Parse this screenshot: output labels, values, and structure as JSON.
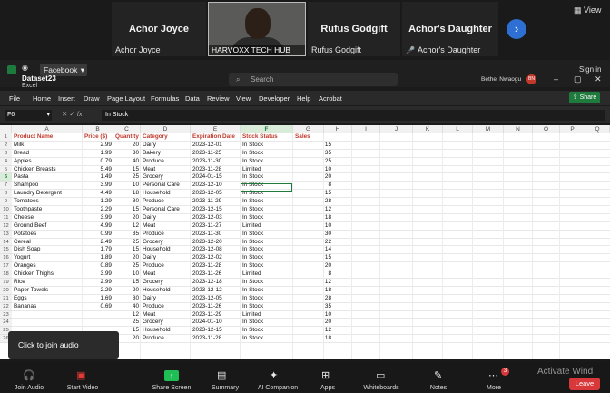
{
  "participants": [
    {
      "big": "Achor Joyce",
      "small": "Achor Joyce"
    },
    {
      "video_label": "HARVOXX TECH HUB"
    },
    {
      "big": "Rufus Godgift",
      "small": "Rufus Godgift"
    },
    {
      "big": "Achor's Daughter",
      "small": "Achor's Daughter"
    }
  ],
  "zoom_view_label": "View",
  "excel": {
    "file_name": "Dataset23",
    "app_name": "Excel",
    "tab_label": "Facebook",
    "search_placeholder": "Search",
    "user_name": "Bethel Nwaogu",
    "user_initials": "BN",
    "sign_in": "Sign in",
    "menu": [
      "File",
      "Home",
      "Insert",
      "Draw",
      "Page Layout",
      "Formulas",
      "Data",
      "Review",
      "View",
      "Developer",
      "Help",
      "Acrobat"
    ],
    "share": "Share",
    "name_box": "F6",
    "formula_value": "In Stock",
    "fx": "fx",
    "columns": [
      "A",
      "B",
      "C",
      "D",
      "E",
      "F",
      "G",
      "H",
      "I",
      "J",
      "K",
      "L",
      "M",
      "N",
      "O",
      "P",
      "Q"
    ],
    "headers": [
      "Product Name",
      "Price ($)",
      "Quantity",
      "Category",
      "Expiration Date",
      "Stock Status",
      "Sales"
    ],
    "rows": [
      [
        "Milk",
        "2.99",
        "20",
        "Dairy",
        "2023-12-01",
        "In Stock",
        "15"
      ],
      [
        "Bread",
        "1.99",
        "30",
        "Bakery",
        "2023-11-25",
        "In Stock",
        "35"
      ],
      [
        "Apples",
        "0.79",
        "40",
        "Produce",
        "2023-11-30",
        "In Stock",
        "25"
      ],
      [
        "Chicken Breasts",
        "5.49",
        "15",
        "Meat",
        "2023-11-28",
        "Limited",
        "10"
      ],
      [
        "Pasta",
        "1.49",
        "25",
        "Grocery",
        "2024-01-15",
        "In Stock",
        "20"
      ],
      [
        "Shampoo",
        "3.99",
        "10",
        "Personal Care",
        "2023-12-10",
        "In Stock",
        "8"
      ],
      [
        "Laundry Detergent",
        "4.49",
        "18",
        "Household",
        "2023-12-05",
        "In Stock",
        "15"
      ],
      [
        "Tomatoes",
        "1.29",
        "30",
        "Produce",
        "2023-11-29",
        "In Stock",
        "28"
      ],
      [
        "Toothpaste",
        "2.29",
        "15",
        "Personal Care",
        "2023-12-15",
        "In Stock",
        "12"
      ],
      [
        "Cheese",
        "3.99",
        "20",
        "Dairy",
        "2023-12-03",
        "In Stock",
        "18"
      ],
      [
        "Ground Beef",
        "4.99",
        "12",
        "Meat",
        "2023-11-27",
        "Limited",
        "10"
      ],
      [
        "Potatoes",
        "0.99",
        "35",
        "Produce",
        "2023-11-30",
        "In Stock",
        "30"
      ],
      [
        "Cereal",
        "2.49",
        "25",
        "Grocery",
        "2023-12-20",
        "In Stock",
        "22"
      ],
      [
        "Dish Soap",
        "1.79",
        "15",
        "Household",
        "2023-12-08",
        "In Stock",
        "14"
      ],
      [
        "Yogurt",
        "1.89",
        "20",
        "Dairy",
        "2023-12-02",
        "In Stock",
        "15"
      ],
      [
        "Oranges",
        "0.89",
        "25",
        "Produce",
        "2023-11-28",
        "In Stock",
        "20"
      ],
      [
        "Chicken Thighs",
        "3.99",
        "10",
        "Meat",
        "2023-11-26",
        "Limited",
        "8"
      ],
      [
        "Rice",
        "2.99",
        "15",
        "Grocery",
        "2023-12-18",
        "In Stock",
        "12"
      ],
      [
        "Paper Towels",
        "2.29",
        "20",
        "Household",
        "2023-12-12",
        "In Stock",
        "18"
      ],
      [
        "Eggs",
        "1.69",
        "30",
        "Dairy",
        "2023-12-05",
        "In Stock",
        "28"
      ],
      [
        "Bananas",
        "0.69",
        "40",
        "Produce",
        "2023-11-26",
        "In Stock",
        "35"
      ],
      [
        "",
        "",
        "12",
        "Meat",
        "2023-11-29",
        "Limited",
        "10"
      ],
      [
        "",
        "",
        "25",
        "Grocery",
        "2024-01-10",
        "In Stock",
        "20"
      ],
      [
        "",
        "",
        "15",
        "Household",
        "2023-12-15",
        "In Stock",
        "12"
      ],
      [
        "",
        "",
        "20",
        "Produce",
        "2023-11-28",
        "In Stock",
        "18"
      ]
    ],
    "row_numbers": [
      "1",
      "2",
      "3",
      "4",
      "5",
      "6",
      "7",
      "8",
      "9",
      "10",
      "11",
      "12",
      "13",
      "14",
      "15",
      "16",
      "17",
      "18",
      "19",
      "20",
      "21",
      "22",
      "23",
      "24",
      "25",
      "26"
    ]
  },
  "join_audio": "Click to join audio",
  "toolbar": [
    "Join Audio",
    "Start Video",
    "Share Screen",
    "Summary",
    "AI Companion",
    "Apps",
    "Whiteboards",
    "Notes",
    "More"
  ],
  "more_badge": "3",
  "leave": "Leave",
  "activate": "Activate Wind"
}
